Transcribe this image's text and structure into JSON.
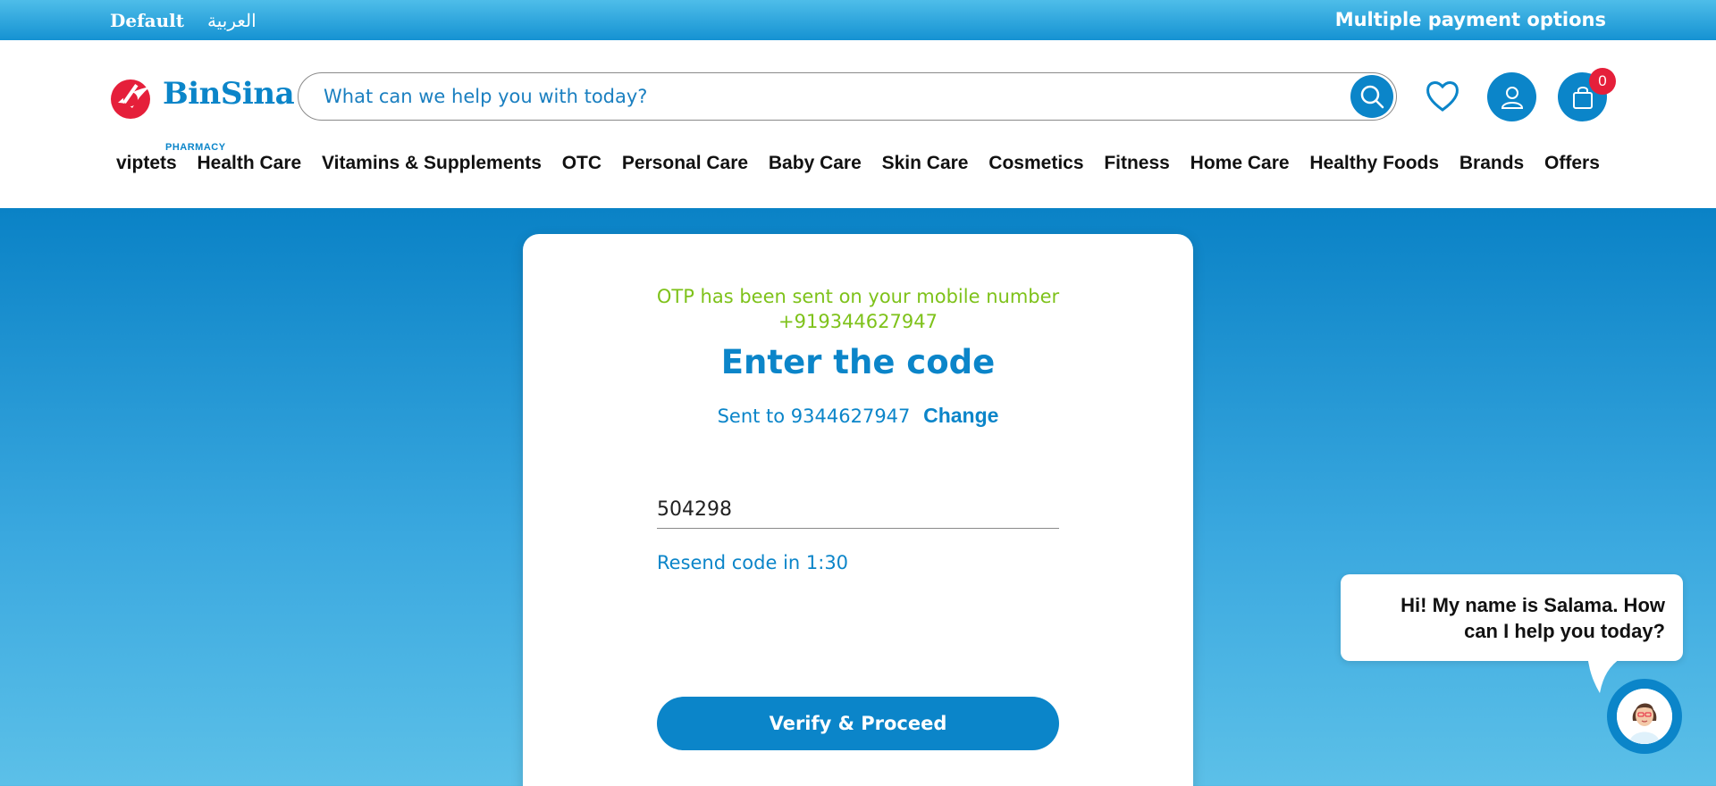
{
  "topbar": {
    "lang_default": "Default",
    "lang_arabic": "العربية",
    "payment_text": "Multiple payment options"
  },
  "header": {
    "brand": "BinSina",
    "brand_sub": "PHARMACY",
    "search_placeholder": "What can we help you with today?",
    "cart_count": "0"
  },
  "nav": {
    "items": [
      "viptets",
      "Health Care",
      "Vitamins & Supplements",
      "OTC",
      "Personal Care",
      "Baby Care",
      "Skin Care",
      "Cosmetics",
      "Fitness",
      "Home Care",
      "Healthy Foods",
      "Brands",
      "Offers"
    ]
  },
  "otp": {
    "message_line1": "OTP has been sent on your mobile number",
    "message_line2": "+919344627947",
    "title": "Enter the code",
    "sent_to": "Sent to 9344627947",
    "change_label": "Change",
    "code_value": "504298",
    "resend_text": "Resend code in 1:30",
    "verify_label": "Verify & Proceed"
  },
  "chat": {
    "line1": "Hi! My name is Salama. How",
    "line2": "can I help you today?"
  },
  "colors": {
    "brand_blue": "#0b85c9",
    "success_green": "#7ec21a",
    "badge_red": "#e51f3a"
  }
}
